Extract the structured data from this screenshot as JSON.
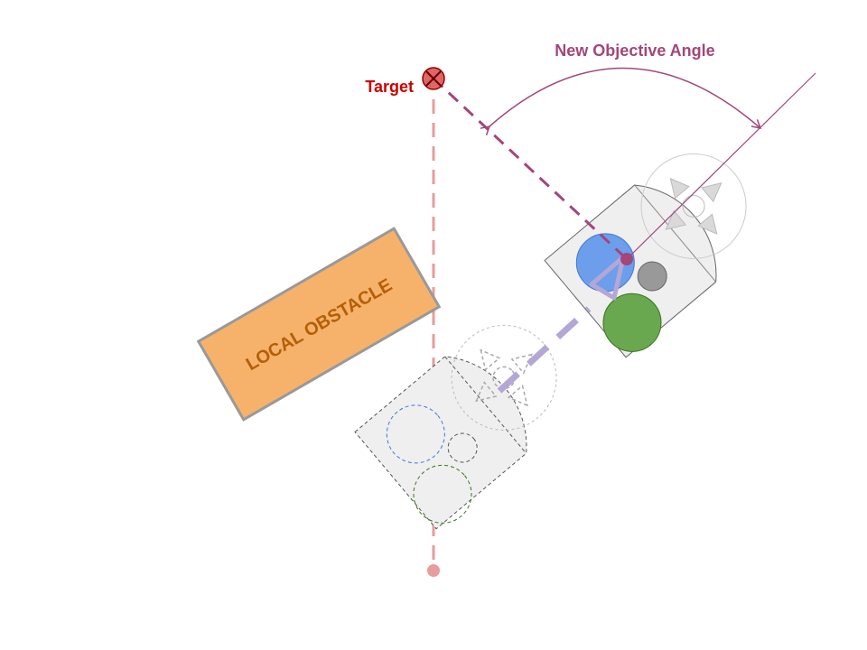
{
  "labels": {
    "angle": "New Objective Angle",
    "target": "Target",
    "obstacle": "LOCAL OBSTACLE"
  },
  "colors": {
    "angle": "#a3467a",
    "target": "#cc0000",
    "path": "#e89c9c",
    "travel": "#b4a7d6",
    "obstacle_fill": "#f6b26b",
    "obstacle_text": "#b45f06",
    "robot_fill": "#efefef",
    "blue": "#6d9eeb",
    "green": "#6aa84f",
    "gray": "#999999"
  },
  "icons": {
    "target": "target-x-icon",
    "arrow": "curved-double-arrow-icon"
  }
}
